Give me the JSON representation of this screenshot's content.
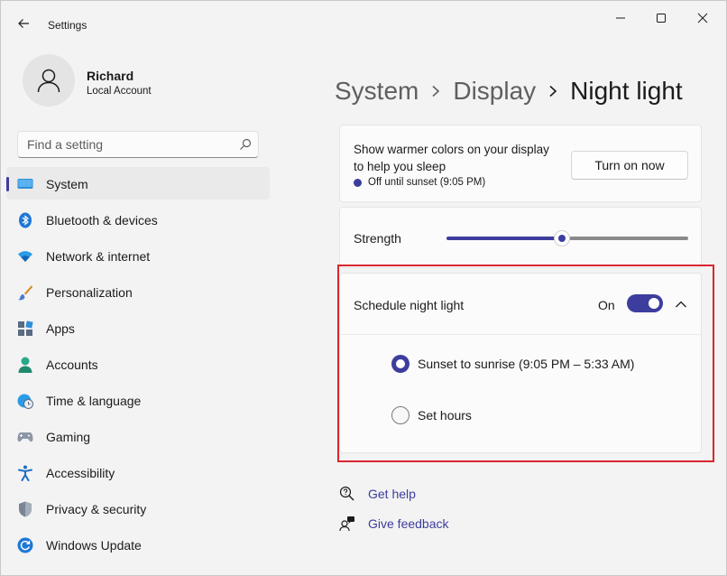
{
  "window": {
    "title": "Settings"
  },
  "profile": {
    "name": "Richard",
    "account_type": "Local Account"
  },
  "search": {
    "placeholder": "Find a setting"
  },
  "sidebar": {
    "items": [
      {
        "label": "System",
        "icon": "monitor-icon",
        "active": true
      },
      {
        "label": "Bluetooth & devices",
        "icon": "bluetooth-icon"
      },
      {
        "label": "Network & internet",
        "icon": "wifi-icon"
      },
      {
        "label": "Personalization",
        "icon": "brush-icon"
      },
      {
        "label": "Apps",
        "icon": "apps-icon"
      },
      {
        "label": "Accounts",
        "icon": "person-icon"
      },
      {
        "label": "Time & language",
        "icon": "globe-clock-icon"
      },
      {
        "label": "Gaming",
        "icon": "gamepad-icon"
      },
      {
        "label": "Accessibility",
        "icon": "accessibility-icon"
      },
      {
        "label": "Privacy & security",
        "icon": "shield-icon"
      },
      {
        "label": "Windows Update",
        "icon": "update-icon"
      }
    ]
  },
  "breadcrumb": {
    "items": [
      "System",
      "Display",
      "Night light"
    ]
  },
  "night_light": {
    "description": "Show warmer colors on your display to help you sleep",
    "status": "Off until sunset (9:05 PM)",
    "turn_on_label": "Turn on now",
    "strength_label": "Strength",
    "strength_value": 0.48,
    "schedule_label": "Schedule night light",
    "schedule_state": "On",
    "options": [
      {
        "label": "Sunset to sunrise (9:05 PM – 5:33 AM)",
        "checked": true
      },
      {
        "label": "Set hours",
        "checked": false
      }
    ]
  },
  "help": {
    "get_help": "Get help",
    "give_feedback": "Give feedback"
  },
  "colors": {
    "accent": "#3d3d9e",
    "highlight": "#d9262e"
  }
}
